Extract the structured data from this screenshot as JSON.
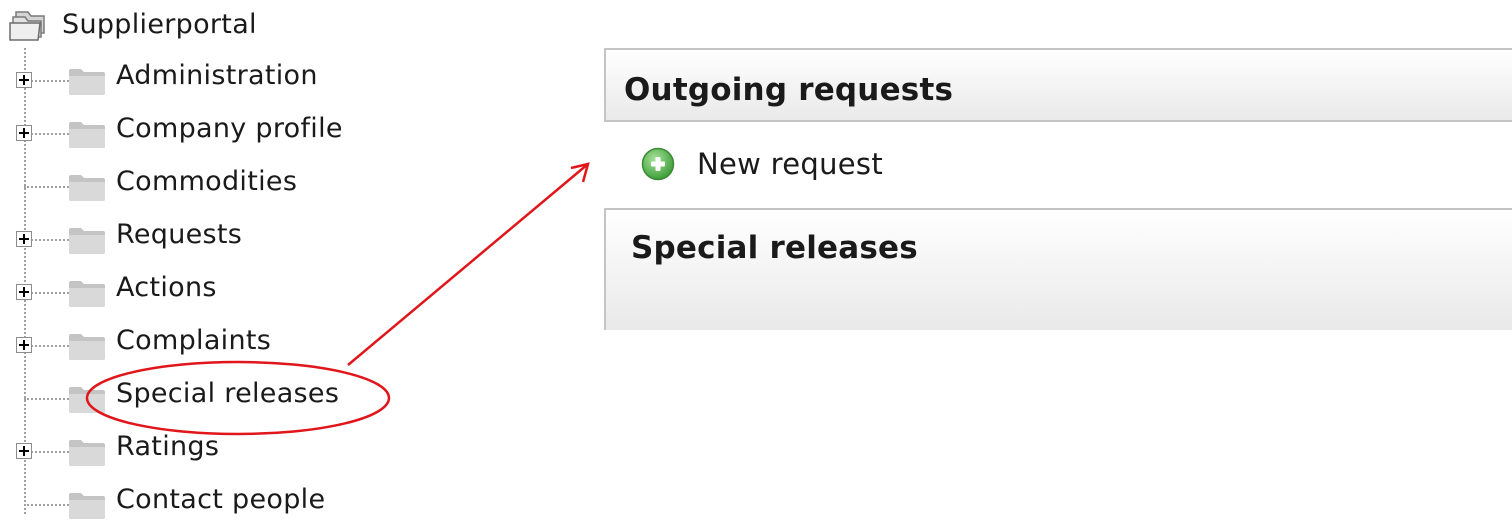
{
  "tree": {
    "root_label": "Supplierportal",
    "items": [
      {
        "label": "Administration",
        "expandable": true
      },
      {
        "label": "Company profile",
        "expandable": true
      },
      {
        "label": "Commodities",
        "expandable": false
      },
      {
        "label": "Requests",
        "expandable": true
      },
      {
        "label": "Actions",
        "expandable": true
      },
      {
        "label": "Complaints",
        "expandable": true
      },
      {
        "label": "Special releases",
        "expandable": false
      },
      {
        "label": "Ratings",
        "expandable": true
      },
      {
        "label": "Contact people",
        "expandable": false
      }
    ]
  },
  "panels": {
    "outgoing_title": "Outgoing requests",
    "new_request_label": "New request",
    "special_title": "Special releases"
  },
  "icons": {
    "root": "folder-stack-icon",
    "item": "folder-icon",
    "expander": "plus-box-icon",
    "add": "green-plus-circle-icon"
  },
  "colors": {
    "annotation": "#e0161b",
    "add_icon": "#4caf50",
    "panel_border": "#c4c4c4"
  }
}
